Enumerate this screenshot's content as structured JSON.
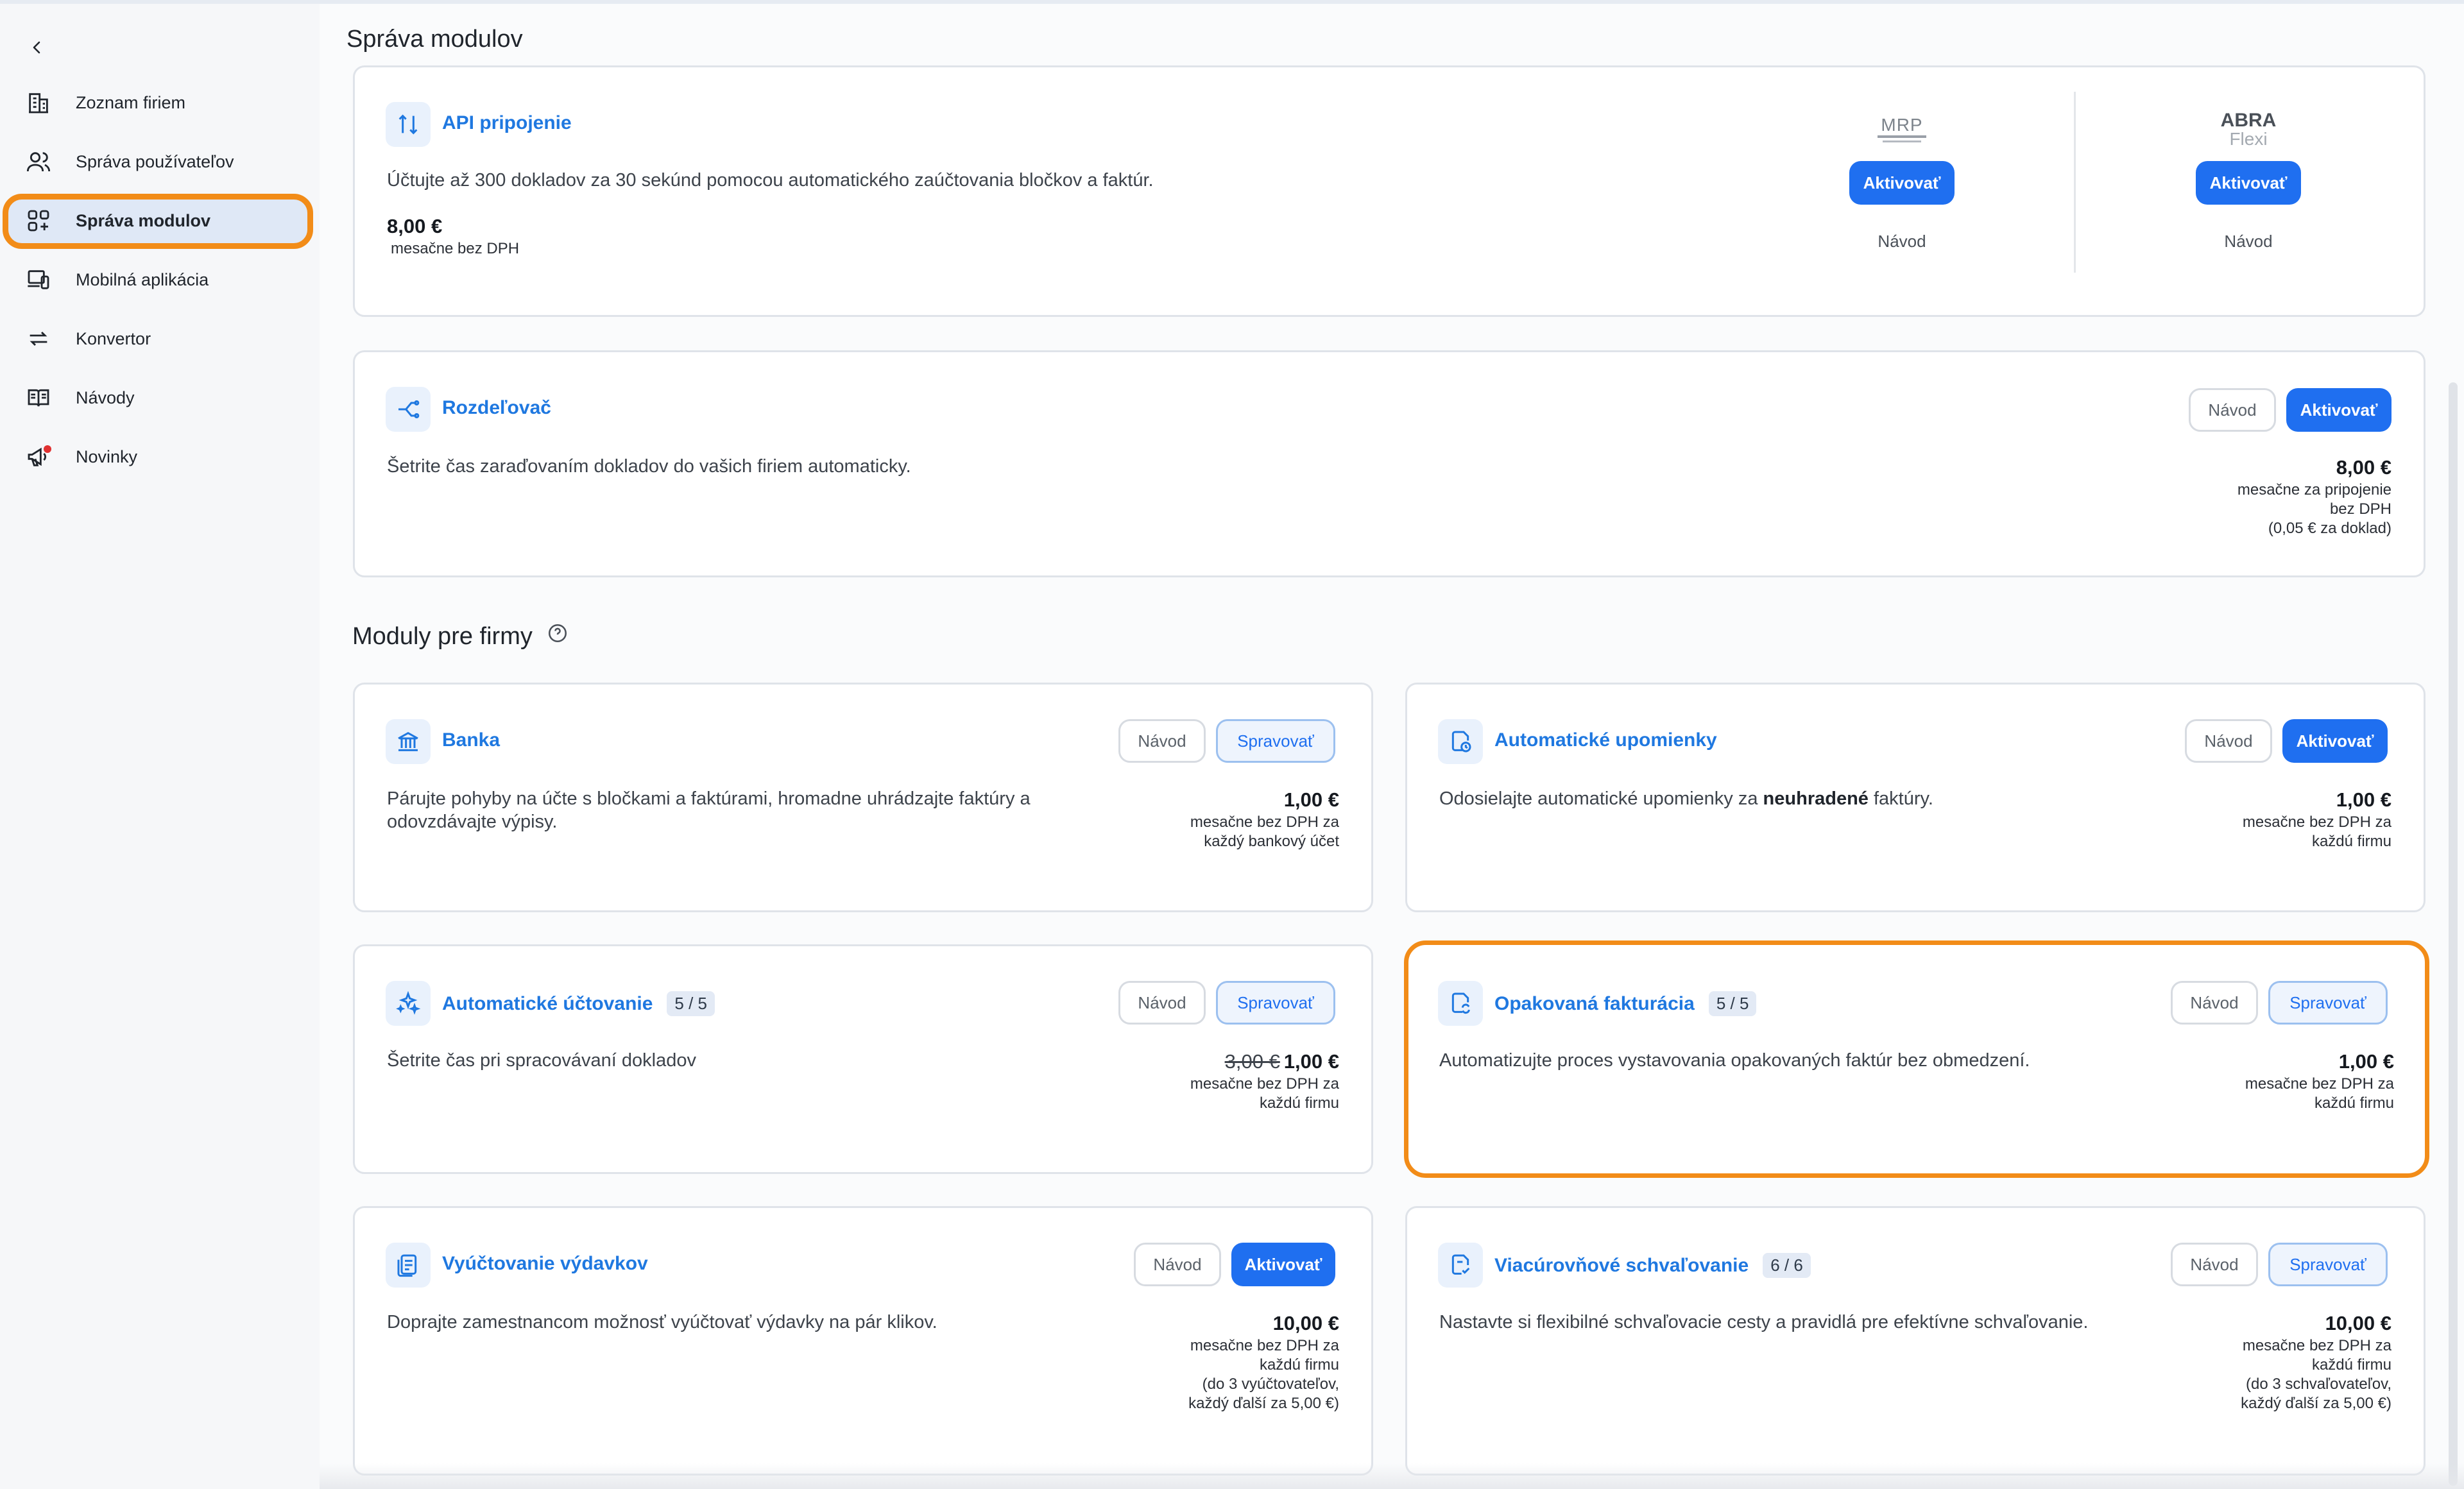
{
  "page_title": "Správa modulov",
  "sidebar": {
    "items": [
      {
        "label": "Zoznam firiem",
        "icon": "building-icon"
      },
      {
        "label": "Správa používateľov",
        "icon": "users-icon"
      },
      {
        "label": "Správa modulov",
        "icon": "modules-grid-icon",
        "active": true
      },
      {
        "label": "Mobilná aplikácia",
        "icon": "mobile-devices-icon"
      },
      {
        "label": "Konvertor",
        "icon": "arrows-swap-icon"
      },
      {
        "label": "Návody",
        "icon": "book-icon"
      },
      {
        "label": "Novinky",
        "icon": "megaphone-icon",
        "badge": true
      }
    ]
  },
  "api": {
    "title": "API pripojenie",
    "description": "Účtujte až 300 dokladov za 30 sekúnd pomocou automatického zaúčtovania bločkov a faktúr.",
    "price": "8,00 €",
    "price_sub": "mesačne bez DPH",
    "integrations": [
      {
        "logo_text": "MRP",
        "button": "Aktivovať",
        "guide": "Návod"
      },
      {
        "logo_text": "ABRA",
        "logo_sub": "Flexi",
        "button": "Aktivovať",
        "guide": "Návod"
      }
    ]
  },
  "rozdelovac": {
    "title": "Rozdeľovač",
    "description": "Šetrite čas zaraďovaním dokladov do vašich firiem automaticky.",
    "guide": "Návod",
    "button": "Aktivovať",
    "price": "8,00 €",
    "price_sub": [
      "mesačne za pripojenie",
      "bez DPH",
      "(0,05 € za doklad)"
    ]
  },
  "section": {
    "title": "Moduly pre firmy"
  },
  "modules": [
    {
      "title": "Banka",
      "counter": "",
      "description": "Párujte pohyby na účte s bločkami a faktúrami, hromadne uhrádzajte faktúry a odovzdávajte výpisy.",
      "guide": "Návod",
      "action": "Spravovať",
      "price": "1,00 €",
      "price_sub": [
        "mesačne bez DPH za",
        "každý bankový účet"
      ]
    },
    {
      "title": "Automatické upomienky",
      "counter": "",
      "description_pre": "Odosielajte automatické upomienky za ",
      "description_bold": "neuhradené",
      "description_post": " faktúry.",
      "guide": "Návod",
      "action": "Aktivovať",
      "price": "1,00 €",
      "price_sub": [
        "mesačne bez DPH za",
        "každú firmu"
      ]
    },
    {
      "title": "Automatické účtovanie",
      "counter": "5 / 5",
      "description": "Šetrite čas pri spracovávaní dokladov",
      "guide": "Návod",
      "action": "Spravovať",
      "old_price": "3,00 €",
      "price": "1,00 €",
      "price_sub": [
        "mesačne bez DPH za",
        "každú firmu"
      ]
    },
    {
      "title": "Opakovaná fakturácia",
      "counter": "5 / 5",
      "description": "Automatizujte proces vystavovania opakovaných faktúr bez obmedzení.",
      "guide": "Návod",
      "action": "Spravovať",
      "price": "1,00 €",
      "price_sub": [
        "mesačne bez DPH za",
        "každú firmu"
      ]
    },
    {
      "title": "Vyúčtovanie výdavkov",
      "counter": "",
      "description": "Doprajte zamestnancom možnosť vyúčtovať výdavky na pár klikov.",
      "guide": "Návod",
      "action": "Aktivovať",
      "price": "10,00 €",
      "price_sub": [
        "mesačne bez DPH za",
        "každú firmu",
        "(do 3 vyúčtovateľov,",
        "každý ďalší za 5,00 €)"
      ]
    },
    {
      "title": "Viacúrovňové schvaľovanie",
      "counter": "6 / 6",
      "description": "Nastavte si flexibilné schvaľovacie cesty a pravidlá pre efektívne schvaľovanie.",
      "guide": "Návod",
      "action": "Spravovať",
      "price": "10,00 €",
      "price_sub": [
        "mesačne bez DPH za",
        "každú firmu",
        "(do 3 schvaľovateľov,",
        "každý ďalší za 5,00 €)"
      ]
    }
  ],
  "colors": {
    "accent": "#1f6ff0",
    "highlight": "#f28c18",
    "active_nav": "#dfe8f6"
  }
}
